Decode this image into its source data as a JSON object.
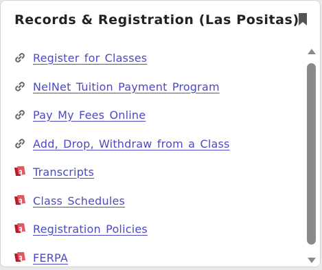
{
  "card": {
    "title": "Records & Registration (Las Positas)",
    "bookmark_icon": "bookmark-icon"
  },
  "links": [
    {
      "label": "Register for Classes",
      "icon": "link-icon"
    },
    {
      "label": "NelNet Tuition Payment Program",
      "icon": "link-icon"
    },
    {
      "label": "Pay My Fees Online",
      "icon": "link-icon"
    },
    {
      "label": "Add, Drop, Withdraw from a Class",
      "icon": "link-icon"
    },
    {
      "label": "Transcripts",
      "icon": "document-icon"
    },
    {
      "label": "Class Schedules",
      "icon": "document-icon"
    },
    {
      "label": "Registration Policies",
      "icon": "document-icon"
    },
    {
      "label": "FERPA",
      "icon": "document-icon"
    }
  ],
  "colors": {
    "link": "#4c49c2",
    "title": "#222222",
    "scroll_thumb": "#8a8a8a",
    "document_icon": "#c0202f"
  }
}
